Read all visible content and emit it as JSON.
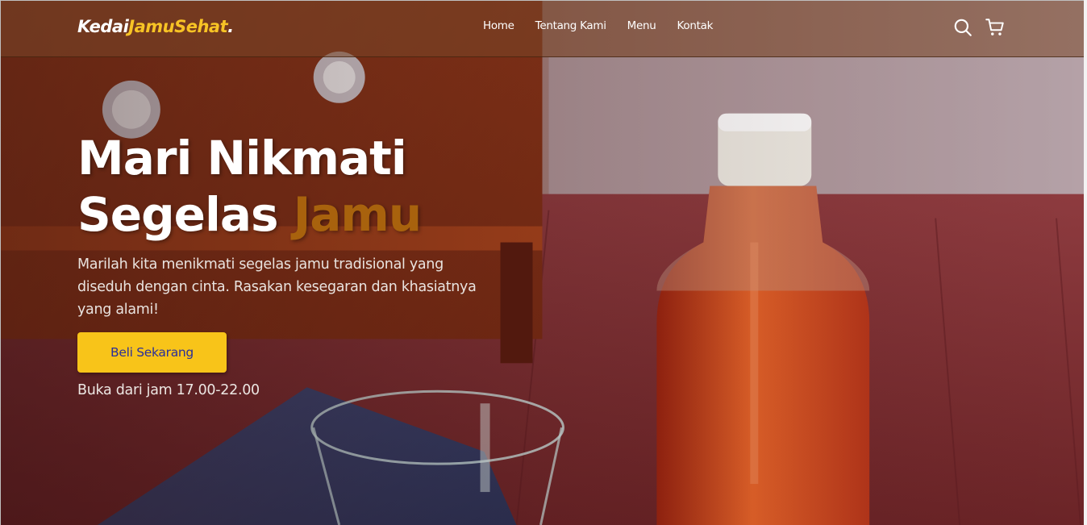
{
  "navbar": {
    "logo_part1": "Kedai",
    "logo_part2": "JamuSehat",
    "logo_part3": ".",
    "links": [
      {
        "label": "Home"
      },
      {
        "label": "Tentang Kami"
      },
      {
        "label": "Menu"
      },
      {
        "label": "Kontak"
      }
    ],
    "icons": [
      "search-icon",
      "shopping-cart-icon"
    ]
  },
  "hero": {
    "title_line1": "Mari Nikmati",
    "title_line2_part1": "Segelas ",
    "title_line2_accent": "Jamu",
    "description": "Marilah kita menikmati segelas jamu tradisional yang diseduh dengan cinta. Rasakan kesegaran dan khasiatnya yang alami!",
    "cta_label": "Beli Sekarang",
    "hours": "Buka dari jam 17.00-22.00"
  },
  "colors": {
    "accent_yellow": "#f8c419",
    "title_accent": "#a8620d",
    "cta_text": "#2a2f9a"
  }
}
